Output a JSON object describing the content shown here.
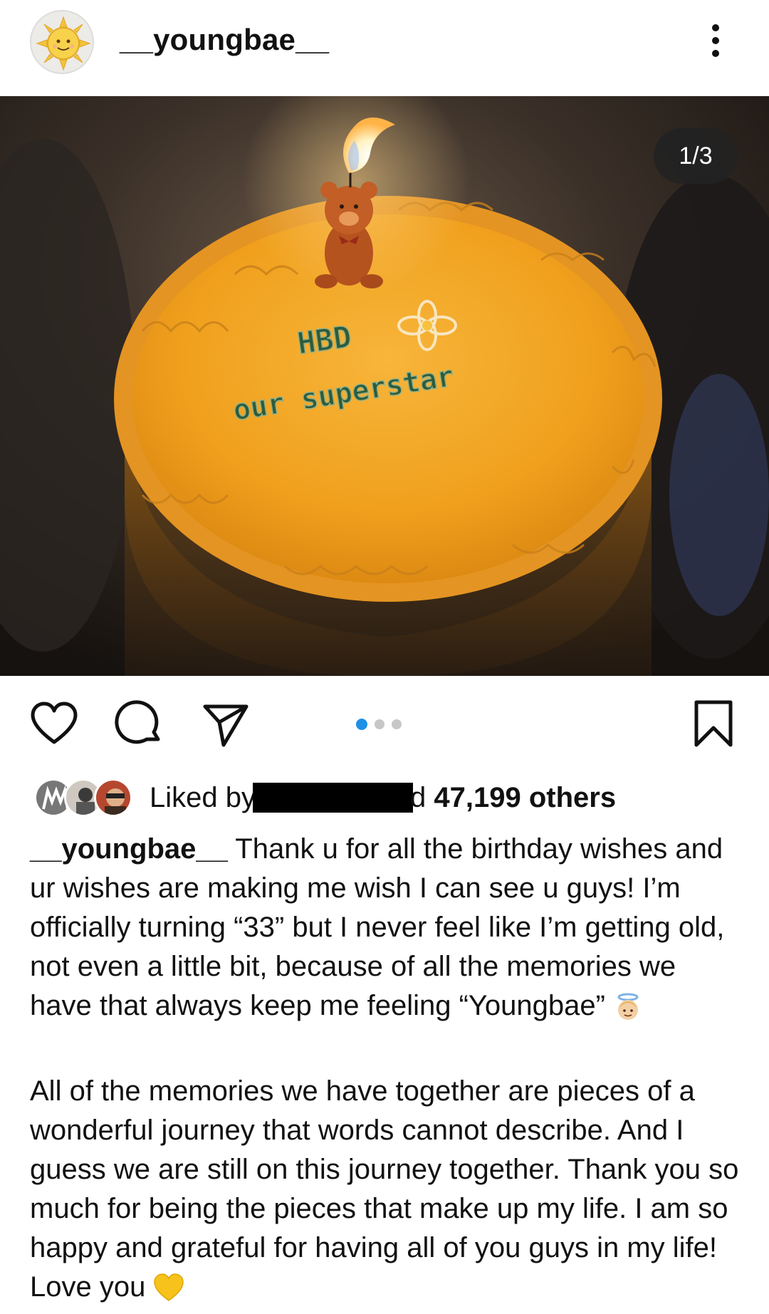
{
  "post": {
    "username": "__youngbae__",
    "slide_counter": "1/3",
    "carousel": {
      "total": 3,
      "active": 1
    }
  },
  "likes": {
    "prefix": "Liked by",
    "suffix": "d",
    "count_text": "47,199 others"
  },
  "caption": {
    "author": "__youngbae__",
    "paragraph1": " Thank u for all the birthday wishes and ur wishes are making me wish I can see u guys! I’m officially turning “33” but I never feel like I’m getting old, not even a little bit, because of all the memories we have that always keep me feeling “Youngbae”",
    "paragraph2": "All of the memories we have together are pieces of a wonderful journey that words cannot describe. And I guess we are still on this journey together. Thank you so much for being the pieces that make up my life. I am so happy and grateful for having all of you guys in my life! Love you"
  },
  "cake_text": {
    "line1": "HBD",
    "line2": "our superstar"
  },
  "icons": {
    "avatar": "sun-avatar-icon",
    "more": "more-vertical-icon",
    "like": "heart-icon",
    "comment": "comment-icon",
    "share": "send-icon",
    "save": "bookmark-icon",
    "caption_emoji_1": "angel-emoji-icon",
    "caption_emoji_2": "yellow-heart-icon"
  },
  "colors": {
    "carousel_active": "#1e90e6",
    "carousel_inactive": "#c7c7c7",
    "frosting": "#f2a21a"
  }
}
